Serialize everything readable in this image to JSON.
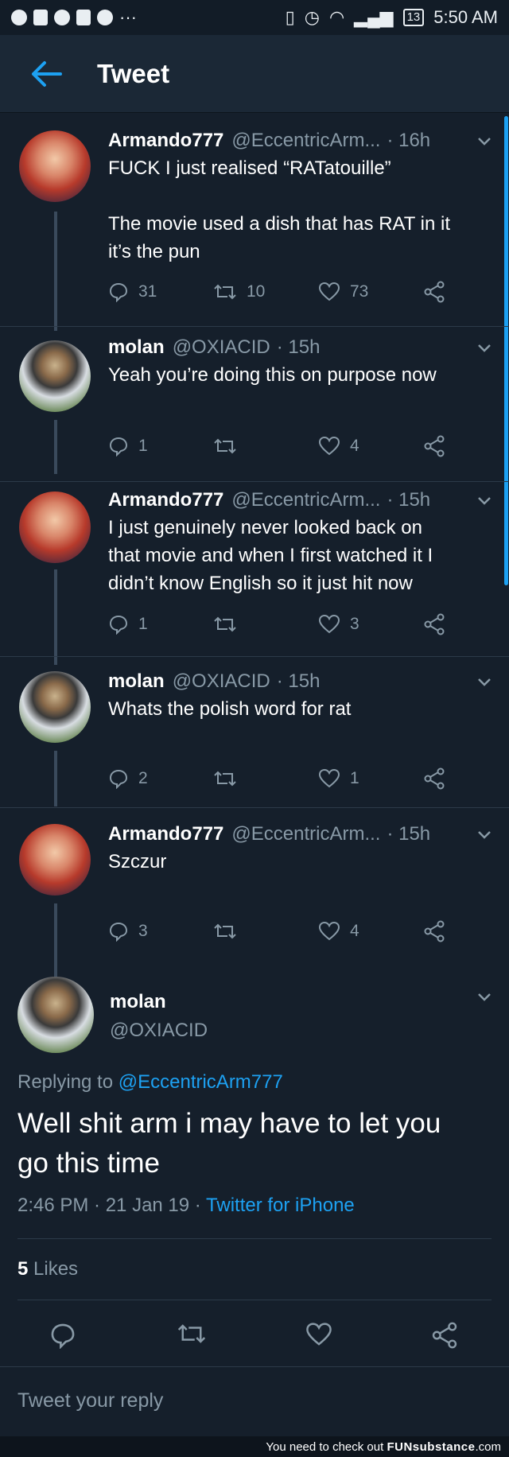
{
  "statusbar": {
    "battery": "13",
    "time": "5:50 AM"
  },
  "header": {
    "title": "Tweet"
  },
  "tweets": [
    {
      "name": "Armando777",
      "handle": "@EccentricArm...",
      "time": "· 16h",
      "lines": [
        "FUCK I just realised “RATatouille”",
        "",
        "The movie used a dish that has RAT in it",
        "it’s the pun"
      ],
      "replies": "31",
      "retweets": "10",
      "likes": "73"
    },
    {
      "name": "molan",
      "handle": "@OXIACID",
      "time": "· 15h",
      "lines": [
        "Yeah you’re doing this on purpose now"
      ],
      "replies": "1",
      "retweets": "",
      "likes": "4"
    },
    {
      "name": "Armando777",
      "handle": "@EccentricArm...",
      "time": "· 15h",
      "lines": [
        "I just genuinely never looked back on",
        "that movie and when I first watched it I",
        "didn’t know English so it just hit now"
      ],
      "replies": "1",
      "retweets": "",
      "likes": "3"
    },
    {
      "name": "molan",
      "handle": "@OXIACID",
      "time": "· 15h",
      "lines": [
        "Whats the polish word for rat"
      ],
      "replies": "2",
      "retweets": "",
      "likes": "1"
    },
    {
      "name": "Armando777",
      "handle": "@EccentricArm...",
      "time": "· 15h",
      "lines": [
        "Szczur"
      ],
      "replies": "3",
      "retweets": "",
      "likes": "4"
    }
  ],
  "main_tweet": {
    "name": "molan",
    "handle": "@OXIACID",
    "replying_prefix": "Replying to",
    "replying_to": "@EccentricArm777",
    "text_lines": [
      "Well shit arm i may have to let you",
      "go this time"
    ],
    "timestamp": "2:46 PM · 21 Jan 19 ·",
    "client": "Twitter for iPhone",
    "likes_count": "5",
    "likes_label": "Likes"
  },
  "reply_bar": {
    "placeholder": "Tweet your reply"
  },
  "footer": {
    "prefix": "You need to check out",
    "brand": "FUNsubstance",
    "suffix": ".com"
  },
  "colors": {
    "background": "#151f2b",
    "accent": "#1da1f2",
    "muted": "#8899a6"
  }
}
